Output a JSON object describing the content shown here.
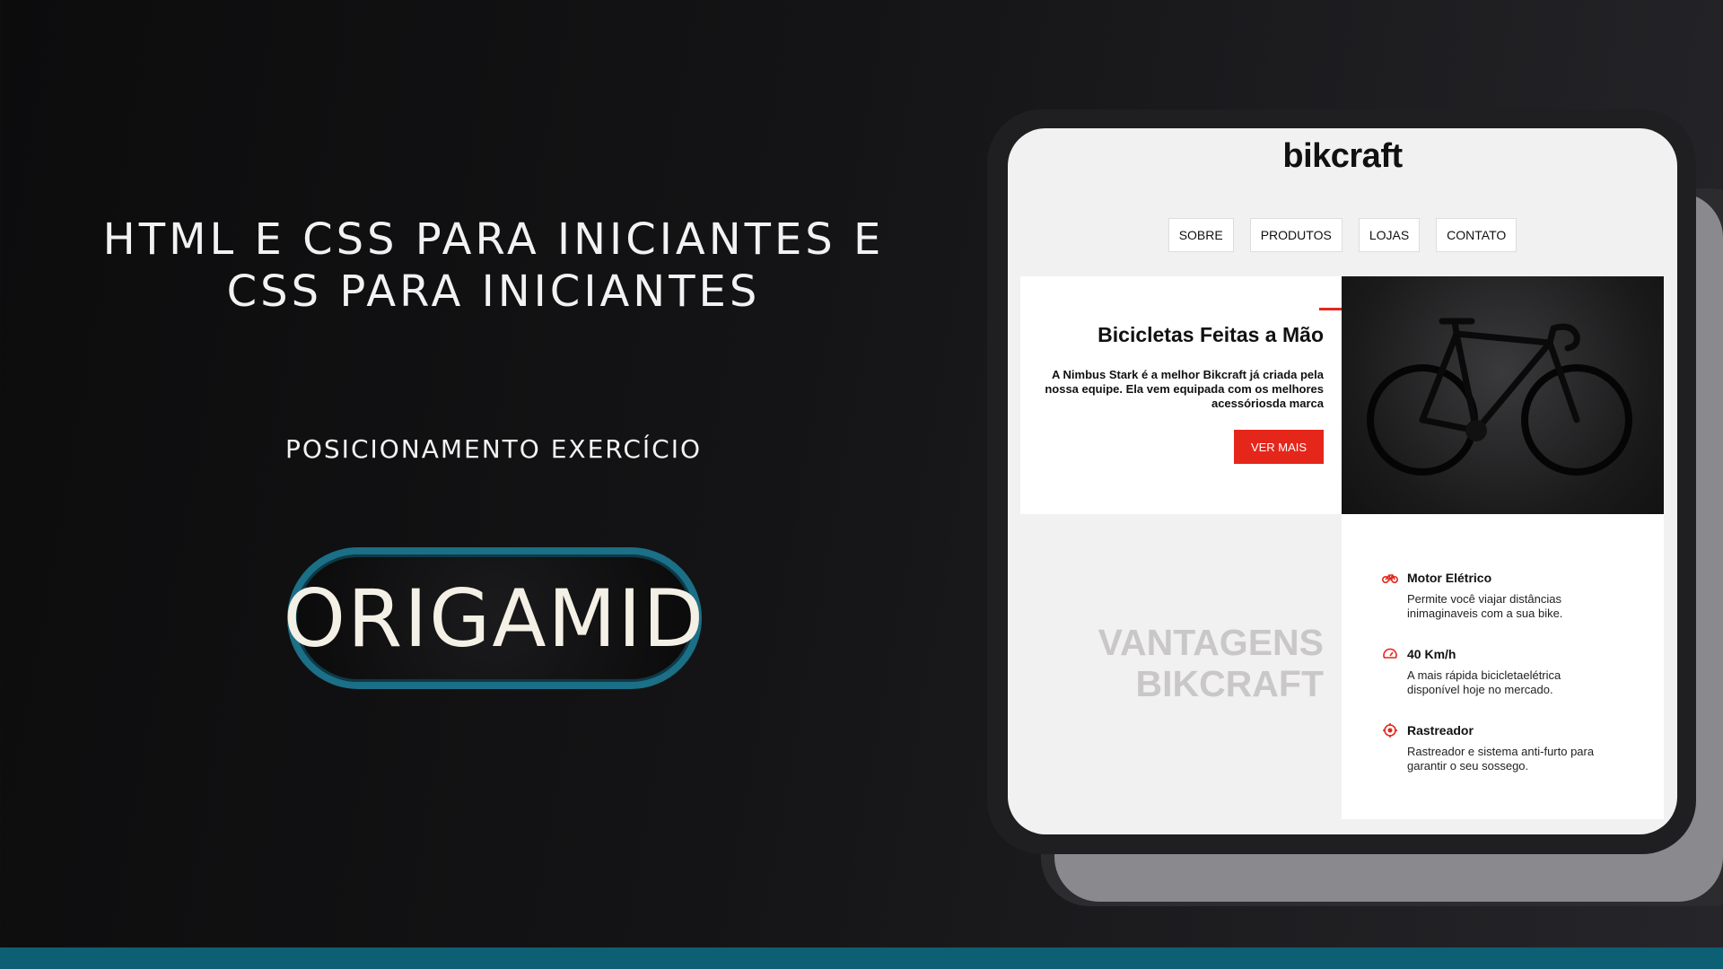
{
  "left": {
    "title": "HTML E CSS PARA INICIANTES E CSS PARA INICIANTES",
    "subtitle": "POSICIONAMENTO EXERCÍCIO",
    "logo_text": "ORIGAMID"
  },
  "site": {
    "logo": "bikcraft",
    "nav": [
      "SOBRE",
      "PRODUTOS",
      "LOJAS",
      "CONTATO"
    ],
    "hero": {
      "title": "Bicicletas Feitas a Mão",
      "text": "A Nimbus Stark é a melhor Bikcraft já criada pela nossa equipe. Ela vem equipada com os melhores acessóriosda marca",
      "button": "VER MAIS"
    },
    "vantagens": [
      "VANTAGENS",
      "BIKCRAFT"
    ],
    "features": [
      {
        "title": "Motor Elétrico",
        "desc": "Permite você viajar distâncias inimaginaveis com a sua bike.",
        "icon": "bike-icon"
      },
      {
        "title": "40 Km/h",
        "desc": "A mais rápida bicicletaelétrica disponível hoje no mercado.",
        "icon": "speedometer-icon"
      },
      {
        "title": "Rastreador",
        "desc": "Rastreador e sistema anti-furto para garantir o seu sossego.",
        "icon": "target-icon"
      }
    ]
  },
  "colors": {
    "accent": "#e5261b",
    "teal": "#0d5f73"
  }
}
